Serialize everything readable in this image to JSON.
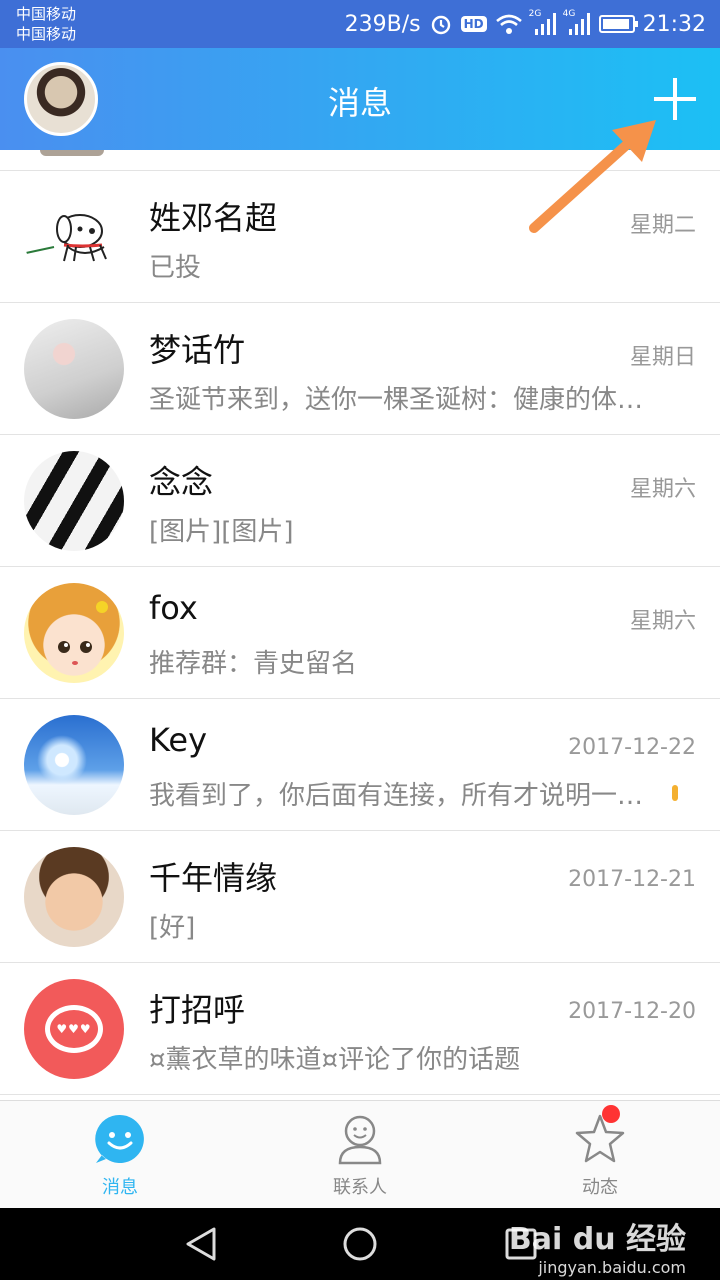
{
  "status_bar": {
    "carrier_1": "中国移动",
    "carrier_2": "中国移动",
    "net_speed": "239B/s",
    "hd": "HD",
    "sig_1": "2G",
    "sig_2": "4G",
    "time": "21:32"
  },
  "header": {
    "title": "消息"
  },
  "conversations": [
    {
      "name": "姓邓名超",
      "time": "星期二",
      "message": "已投",
      "avatar": "dog-icon"
    },
    {
      "name": "梦话竹",
      "time": "星期日",
      "message": "圣诞节来到，送你一棵圣诞树：健康的体…",
      "avatar": "dreamy-photo"
    },
    {
      "name": "念念",
      "time": "星期六",
      "message": "[图片][图片]",
      "avatar": "piano-photo"
    },
    {
      "name": "fox",
      "time": "星期六",
      "message": "推荐群：青史留名",
      "avatar": "cartoon-girl"
    },
    {
      "name": "Key",
      "time": "2017-12-22",
      "message": "我看到了，你后面有连接，所有才说明一…",
      "avatar": "snow-sun-photo"
    },
    {
      "name": "千年情缘",
      "time": "2017-12-21",
      "message": "[好]",
      "avatar": "baby-photo"
    },
    {
      "name": "打招呼",
      "time": "2017-12-20",
      "message": "¤薰衣草的味道¤评论了你的话题",
      "avatar": "greeting-bubble-icon"
    }
  ],
  "tabs": [
    {
      "label": "消息",
      "icon": "message-smile-icon",
      "active": true
    },
    {
      "label": "联系人",
      "icon": "contact-person-icon",
      "active": false
    },
    {
      "label": "动态",
      "icon": "star-icon",
      "active": false,
      "badge": true
    }
  ],
  "watermark": {
    "main": "Bai du 经验",
    "sub": "jingyan.baidu.com"
  },
  "colors": {
    "header_start": "#4a8ff0",
    "header_end": "#1cc0f4",
    "active_tab": "#2fb5f1",
    "badge": "#ff3333",
    "annotation_arrow": "#f5924a"
  }
}
